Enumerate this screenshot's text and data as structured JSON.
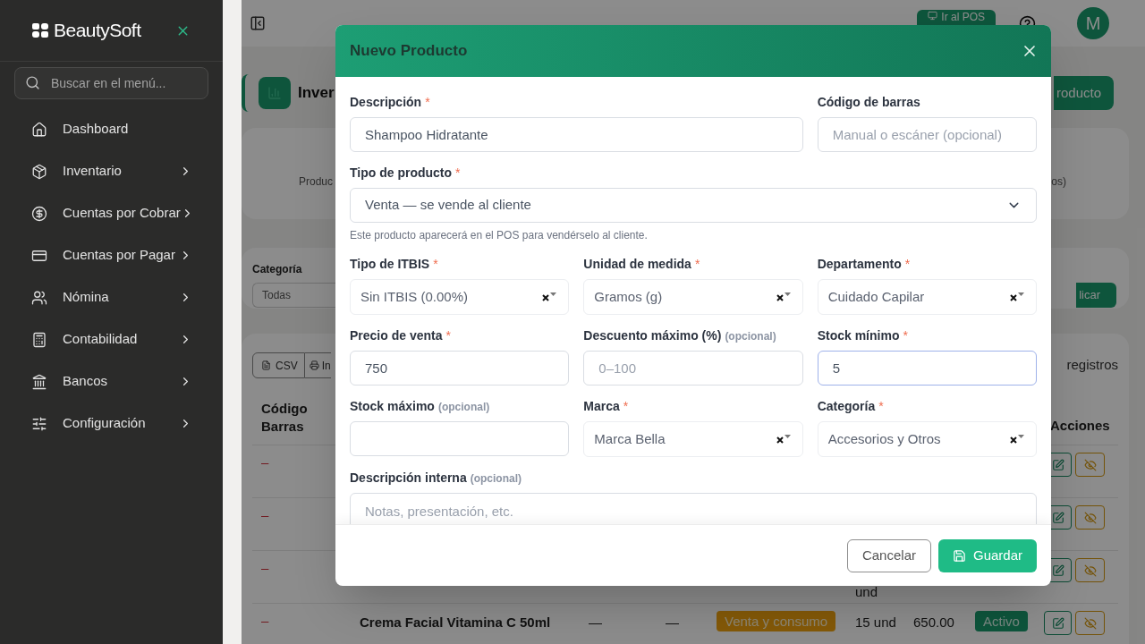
{
  "sidebar": {
    "brand": "BeautySoft",
    "search": {
      "placeholder": "Buscar en el menú..."
    },
    "items": [
      {
        "label": "Dashboard",
        "submenu": false
      },
      {
        "label": "Inventario",
        "submenu": true
      },
      {
        "label": "Cuentas por Cobrar",
        "submenu": true
      },
      {
        "label": "Cuentas por Pagar",
        "submenu": true
      },
      {
        "label": "Nómina",
        "submenu": true
      },
      {
        "label": "Contabilidad",
        "submenu": true
      },
      {
        "label": "Bancos",
        "submenu": true
      },
      {
        "label": "Configuración",
        "submenu": true
      }
    ]
  },
  "topbar": {
    "pos_button": "Ir al POS",
    "avatar": "M"
  },
  "page": {
    "title": "Inver",
    "new_button": "roducto",
    "stats_left": "Produc",
    "stats_right": "os)",
    "filter": {
      "label": "Categoría",
      "value": "Todas",
      "apply_button": "licar"
    },
    "table": {
      "export_buttons": [
        "CSV",
        "In"
      ],
      "page_size_label": "registros",
      "columns": [
        "Código Barras",
        "Acciones"
      ],
      "rows": [
        {
          "code": "–"
        },
        {
          "code": "–"
        },
        {
          "code": "–",
          "stock_line_2": "und"
        },
        {
          "code": "–",
          "name": "Crema Facial Vitamina C 50ml",
          "column_3": "—",
          "column_4": "—",
          "type": "Venta y consumo",
          "stock": "15 und",
          "price": "650.00",
          "status": "Activo"
        }
      ]
    }
  },
  "modal": {
    "title": "Nuevo Producto",
    "sections": [
      {
        "fields": [
          {
            "kind": "text",
            "label": "Descripción",
            "required_mark": "*",
            "value": "Shampoo Hidratante",
            "focused": false
          },
          {
            "kind": "text",
            "label": "Código de barras",
            "placeholder": "Manual o escáner (opcional)",
            "focused": false
          }
        ]
      },
      {
        "fields": [
          {
            "kind": "select",
            "label": "Tipo de producto",
            "required_mark": "*",
            "value": "Venta — se vende al cliente",
            "hint": "Este producto aparecerá en el POS para vendérselo al cliente."
          }
        ]
      },
      {
        "fields": [
          {
            "kind": "combo",
            "label": "Tipo de ITBIS",
            "required_mark": "*",
            "value": "Sin ITBIS (0.00%)"
          },
          {
            "kind": "combo",
            "label": "Unidad de medida",
            "required_mark": "*",
            "value": "Gramos (g)"
          },
          {
            "kind": "combo",
            "label": "Departamento",
            "required_mark": "*",
            "value": "Cuidado Capilar"
          }
        ]
      },
      {
        "fields": [
          {
            "kind": "text",
            "label": "Precio de venta",
            "required_mark": "*",
            "value": "750",
            "focused": false
          },
          {
            "kind": "text",
            "label": "Descuento máximo (%)",
            "optional_note": "(opcional)",
            "placeholder": "0–100",
            "focused": false
          },
          {
            "kind": "text",
            "label": "Stock mínimo",
            "required_mark": "*",
            "value": "5",
            "focused": true
          }
        ]
      },
      {
        "fields": [
          {
            "kind": "text",
            "label": "Stock máximo",
            "optional_note": "(opcional)",
            "focused": false
          },
          {
            "kind": "combo",
            "label": "Marca",
            "required_mark": "*",
            "value": "Marca Bella"
          },
          {
            "kind": "combo",
            "label": "Categoría",
            "required_mark": "*",
            "value": "Accesorios y Otros"
          }
        ]
      },
      {
        "fields": [
          {
            "kind": "textarea",
            "label": "Descripción interna",
            "optional_note": "(opcional)",
            "placeholder": "Notas, presentación, etc."
          }
        ]
      }
    ],
    "cancel_button": "Cancelar",
    "save_button": "Guardar"
  }
}
